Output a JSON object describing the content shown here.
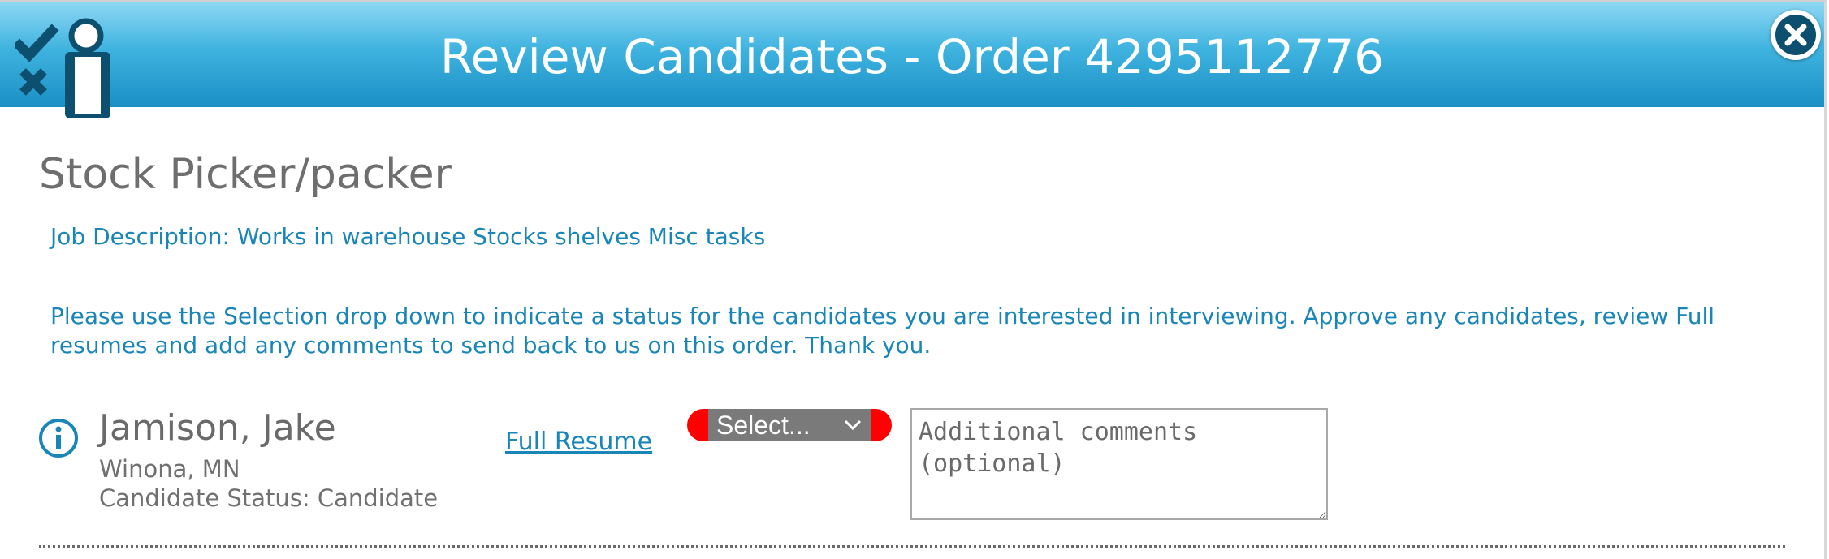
{
  "header": {
    "title": "Review Candidates - Order 4295112776"
  },
  "job": {
    "title": "Stock Picker/packer",
    "description": "Job Description: Works in warehouse Stocks shelves Misc tasks",
    "instructions": "Please use the Selection drop down to indicate a status for the candidates you are interested in interviewing. Approve any candidates, review Full resumes and add any comments to send back to us on this order. Thank you."
  },
  "candidates": [
    {
      "name": "Jamison, Jake",
      "location": "Winona, MN",
      "status": "Candidate Status: Candidate",
      "resume_link": "Full Resume",
      "selection": "Select...",
      "comments_placeholder": "Additional comments (optional)",
      "comments_value": ""
    }
  ],
  "colors": {
    "header_top": "#8ed8f4",
    "header_bottom": "#1a8fc4",
    "accent_text": "#1a86b8",
    "select_border": "#ff0000",
    "select_fill": "#7a7a7a",
    "logo_dark": "#0d4f6e"
  },
  "icons": {
    "logo": "candidate-review-logo-icon",
    "close": "close-icon",
    "info": "info-icon",
    "chevron": "chevron-down-icon"
  }
}
